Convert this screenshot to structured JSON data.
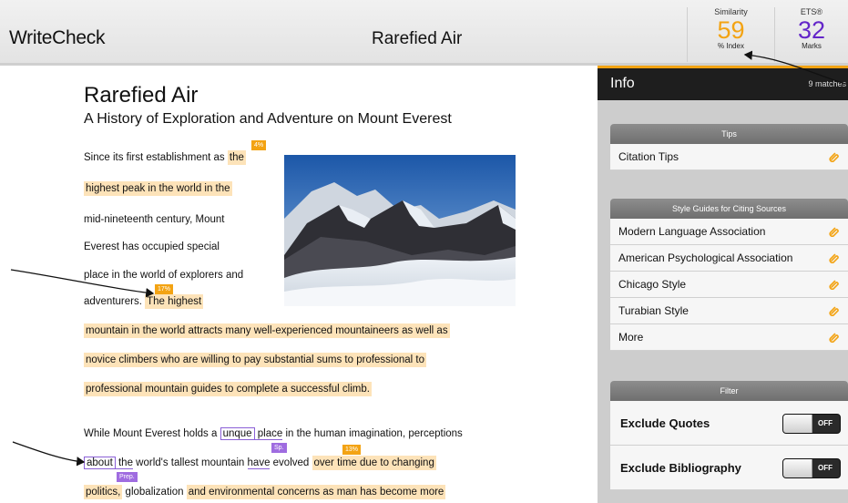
{
  "app": {
    "brand": "WriteCheck",
    "doc_title": "Rarefied Air"
  },
  "metrics": {
    "similarity": {
      "label": "Similarity",
      "value": "59",
      "sub": "% Index"
    },
    "ets": {
      "label": "ETS®",
      "value": "32",
      "sub": "Marks"
    }
  },
  "document": {
    "title": "Rarefied Air",
    "subtitle": "A History of Exploration and Adventure on Mount Everest",
    "p1": {
      "l1": "Since its first establishment as ",
      "l1_hl": "the",
      "l2": "highest peak in the world in the",
      "l3": "mid-nineteenth century, Mount",
      "l4": "Everest has occupied special",
      "l5": "place in the world of explorers and",
      "l6": "adventurers. ",
      "l6_hl": "The highest",
      "l7": "mountain in the world attracts many well-experienced mountaineers as well as",
      "l8": "novice climbers who are willing to pay substantial sums to professional to",
      "l9": "professional mountain guides to complete a successful climb."
    },
    "p2": {
      "l1a": "While Mount Everest holds a ",
      "l1_word": "unque",
      "l1b": " place",
      "l1c": " in the human imagination, perceptions",
      "l2_word": "about",
      "l2a": " the",
      "l2b": " world's tallest mountain ",
      "l2_word2": "have",
      "l2c": " evolved ",
      "l2_hl": "over time due to changing",
      "l3_hl": "politics,",
      "l3a": " globalization ",
      "l3_hl2": "and environmental concerns as man has become more"
    },
    "tags": {
      "t1": "4%",
      "t2": "17%",
      "t3": "13%",
      "sp": "Sp.",
      "prep": "Prep."
    }
  },
  "panel": {
    "title": "Info",
    "matches": "9 matches",
    "tips": {
      "title": "Tips",
      "items": [
        "Citation Tips"
      ]
    },
    "style_guides": {
      "title": "Style Guides for Citing Sources",
      "items": [
        "Modern Language Association",
        "American Psychological Association",
        "Chicago Style",
        "Turabian Style",
        "More"
      ]
    },
    "filter": {
      "title": "Filter",
      "items": [
        {
          "label": "Exclude Quotes",
          "state": "OFF"
        },
        {
          "label": "Exclude Bibliography",
          "state": "OFF"
        }
      ]
    }
  },
  "colors": {
    "accent_orange": "#f3a313",
    "accent_purple": "#6426c9",
    "highlight": "#fde3b9",
    "grammar_purple": "#9f6ce0"
  },
  "icons": {
    "clip": "paperclip-icon"
  }
}
